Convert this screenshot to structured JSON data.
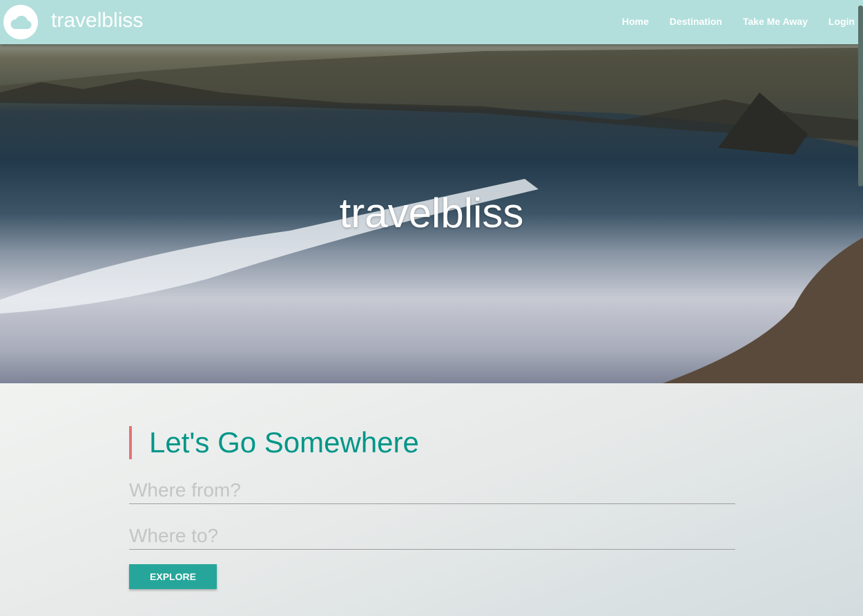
{
  "nav": {
    "brand": "travelbliss",
    "logo_icon": "cloud-icon",
    "links": [
      "Home",
      "Destination",
      "Take Me Away",
      "Login"
    ]
  },
  "hero": {
    "title": "travelbliss"
  },
  "search": {
    "heading": "Let's Go Somewhere",
    "from_placeholder": "Where from?",
    "to_placeholder": "Where to?",
    "explore_label": "EXPLORE"
  },
  "colors": {
    "nav": "#b2dfdb",
    "accent": "#009688",
    "button": "#26a69a",
    "heading_bar": "#e57373"
  }
}
